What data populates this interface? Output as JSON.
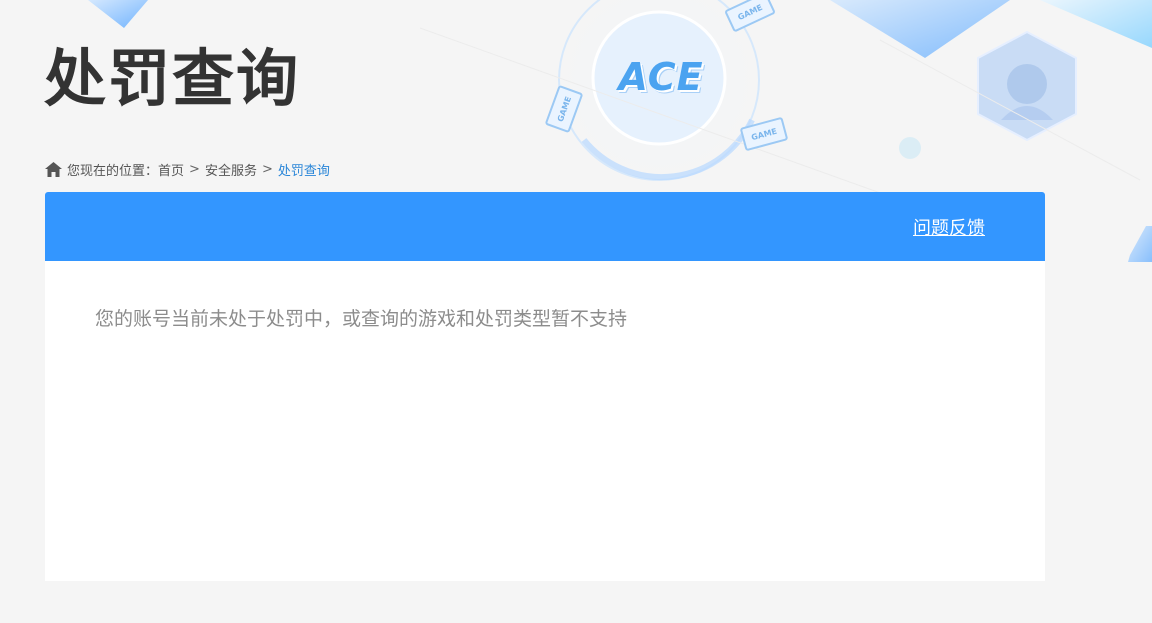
{
  "page": {
    "title": "处罚查询"
  },
  "breadcrumb": {
    "prefix": "您现在的位置：",
    "items": [
      "首页",
      "安全服务"
    ],
    "separator": ">",
    "current": "处罚查询"
  },
  "panel": {
    "feedback_label": "问题反馈",
    "message": "您的账号当前未处于处罚中，或查询的游戏和处罚类型暂不支持"
  },
  "decor": {
    "logo_text": "ACE",
    "tag_text": "GAME"
  },
  "colors": {
    "accent": "#3396ff",
    "title": "#333333",
    "breadcrumb_current": "#2a86d8",
    "message": "#8c8c8c",
    "background": "#f5f5f5"
  }
}
